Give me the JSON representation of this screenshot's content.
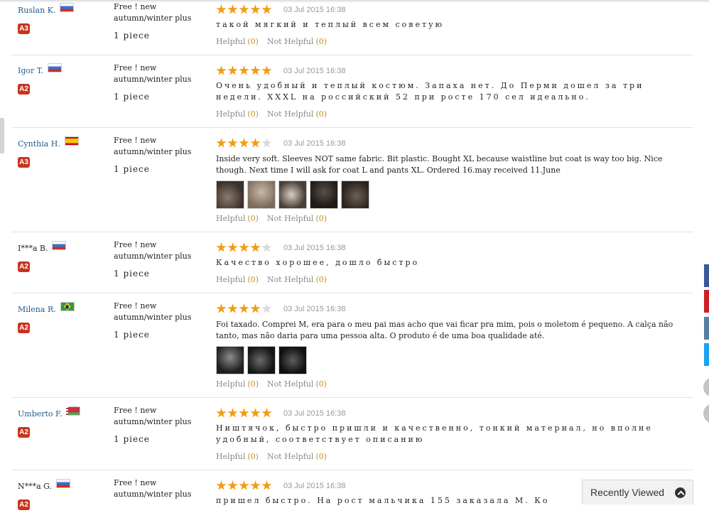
{
  "product_line1": "Free ! new",
  "product_line2": "autumn/winter plus",
  "quantity": "1 piece",
  "helpful_label": "Helpful",
  "not_helpful_label": "Not Helpful",
  "helpful_count": "(0)",
  "not_helpful_count": "(0)",
  "recently_viewed": "Recently Viewed",
  "reviews": [
    {
      "name": "Ruslan K.",
      "flag": "russia",
      "badge": "A3",
      "rating": 5,
      "date": "03 Jul 2015 16:38",
      "text": "такой мягкий и теплый всем советую"
    },
    {
      "name": "Igor T.",
      "flag": "russia",
      "badge": "A2",
      "rating": 5,
      "date": "03 Jul 2015 16:38",
      "text": "Очень удобный и теплый костюм. Запаха нет. До Перми дошел за три недели. XXXL на российский 52 при росте 170 сел идеально."
    },
    {
      "name": "Cynthia H.",
      "flag": "spain",
      "badge": "A3",
      "rating": 4,
      "date": "03 Jul 2015 16:38",
      "text": "Inside very soft. Sleeves NOT same fabric. Bit plastic. Bought XL because waistline but coat is way too big. Nice though. Next time I will ask for coat L and pants XL. Ordered 16.may received 11.June",
      "photos": 5
    },
    {
      "name": "I***a B.",
      "flag": "russia",
      "badge": "A2",
      "rating": 4,
      "date": "03 Jul 2015 16:38",
      "text": "Качество хорошее, дошло быстро"
    },
    {
      "name": "Milena R.",
      "flag": "brazil",
      "badge": "A2",
      "rating": 4,
      "date": "03 Jul 2015 16:38",
      "text": "Foi taxado. Comprei M, era para o meu pai mas acho que vai ficar pra mim, pois o moletom é pequeno. A calça não tanto, mas não daria para uma pessoa alta. O produto é de uma boa qualidade até.",
      "photos": 3
    },
    {
      "name": "Umberto F.",
      "flag": "belarus",
      "badge": "A2",
      "rating": 5,
      "date": "03 Jul 2015 16:38",
      "text": "Ништячок, быстро пришли и качественно, тонкий материал, но вполне удобный, соответствует описанию"
    },
    {
      "name": "N***a G.",
      "flag": "russia",
      "badge": "A2",
      "rating": 5,
      "date": "03 Jul 2015 16:38",
      "text": "пришел быстро. На рост мальчика 155 заказала М. Ко"
    }
  ],
  "colors": {
    "accent_star": "#f39c12",
    "badge": "#c9341e",
    "link": "#1f5b8f",
    "count": "#c98a24",
    "share_facebook": "#3b5998",
    "share_pinterest": "#cb2027",
    "share_vk": "#587ea3",
    "share_twitter": "#1da1f2"
  }
}
